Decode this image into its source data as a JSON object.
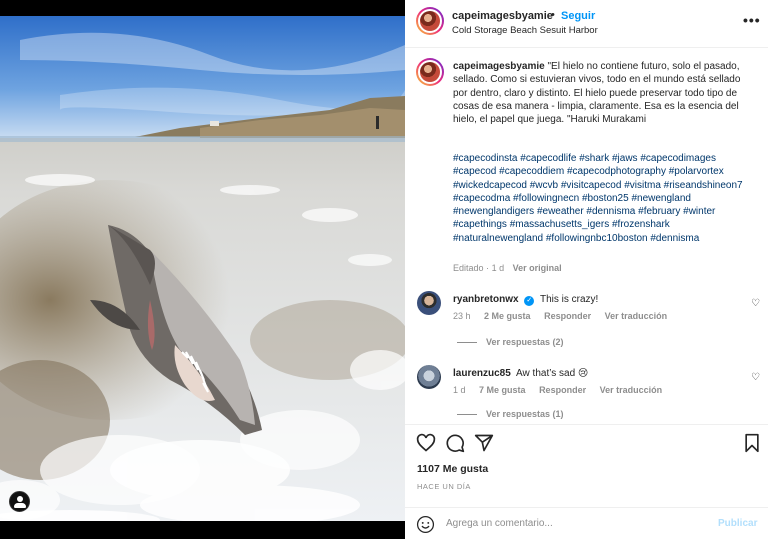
{
  "post": {
    "username": "capeimagesbyamie",
    "separator": "•",
    "follow_label": "Seguir",
    "location": "Cold Storage Beach Sesuit Harbor",
    "more_label": "•••"
  },
  "caption": {
    "username": "capeimagesbyamie",
    "text": "\"El hielo no contiene futuro, solo el pasado, sellado. Como si estuvieran vivos, todo en el mundo está sellado por dentro, claro y distinto. El hielo puede preservar todo tipo de cosas de esa manera - limpia, claramente. Esa es la esencia del hielo, el papel que juega. \"Haruki Murakami",
    "hashtags": "#capecodinsta #capecodlife #shark #jaws #capecodimages #capecod #capecoddiem #capecodphotography #polarvortex #wickedcapecod #wcvb #visitcapecod #visitma #riseandshineon7 #capecodma #followingnecn #boston25 #newengland #newenglandigers #eweather #dennisma #february #winter #capethings #massachusetts_igers #frozenshark #naturalnewengland #followingnbc10boston #dennisma",
    "edited": "Editado",
    "dot": "·",
    "time": "1 d",
    "see_translation": "Ver original"
  },
  "comments": [
    {
      "username": "ryanbretonwx",
      "verified": true,
      "text": "This is crazy!",
      "time": "23 h",
      "likes": "2 Me gusta",
      "reply": "Responder",
      "translate": "Ver traducción",
      "replies": "Ver respuestas (2)"
    },
    {
      "username": "laurenzuc85",
      "verified": false,
      "text": "Aw that’s sad 😢",
      "time": "1 d",
      "likes": "7 Me gusta",
      "reply": "Responder",
      "translate": "Ver traducción",
      "replies": "Ver respuestas (1)"
    }
  ],
  "actions": {
    "likes": "1107 Me gusta",
    "ago": "HACE UN DÍA",
    "add_comment_placeholder": "Agrega un comentario...",
    "publish_label": "Publicar",
    "icons": [
      "heart-icon",
      "comment-icon",
      "share-icon",
      "bookmark-icon",
      "emoji-icon"
    ]
  },
  "colors": {
    "link": "#0095f6",
    "hashtag": "#00376b",
    "secondary_text": "#8e8e8e",
    "publish_disabled": "#b2dffc"
  }
}
